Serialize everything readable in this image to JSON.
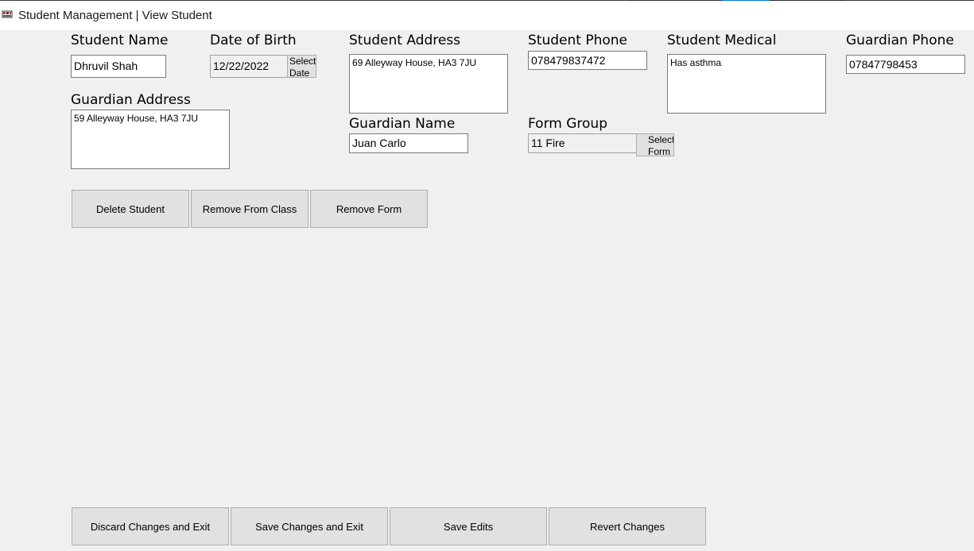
{
  "window": {
    "title": "Student Management | View Student"
  },
  "colors": {
    "window_bg": "#f0f0f0",
    "button_bg": "#e1e1e1",
    "accent": "#0078d7"
  },
  "fields": {
    "student_name": {
      "label": "Student Name",
      "value": "Dhruvil Shah"
    },
    "date_of_birth": {
      "label": "Date of Birth",
      "value": "12/22/2022",
      "button": "Select Date"
    },
    "student_address": {
      "label": "Student Address",
      "value": "69 Alleyway House, HA3 7JU"
    },
    "student_phone": {
      "label": "Student Phone",
      "value": "078479837472"
    },
    "student_medical": {
      "label": "Student Medical",
      "value": "Has asthma"
    },
    "guardian_phone": {
      "label": "Guardian Phone",
      "value": "07847798453"
    },
    "guardian_address": {
      "label": "Guardian Address",
      "value": "59 Alleyway House, HA3 7JU"
    },
    "guardian_name": {
      "label": "Guardian Name",
      "value": "Juan Carlo"
    },
    "form_group": {
      "label": "Form Group",
      "value": "11 Fire",
      "button": "Select Form"
    }
  },
  "actions": {
    "delete_student": "Delete Student",
    "remove_from_class": "Remove From Class",
    "remove_form": "Remove Form"
  },
  "footer": {
    "discard": "Discard Changes and Exit",
    "save_exit": "Save Changes and Exit",
    "save_edits": "Save Edits",
    "revert": "Revert Changes"
  }
}
